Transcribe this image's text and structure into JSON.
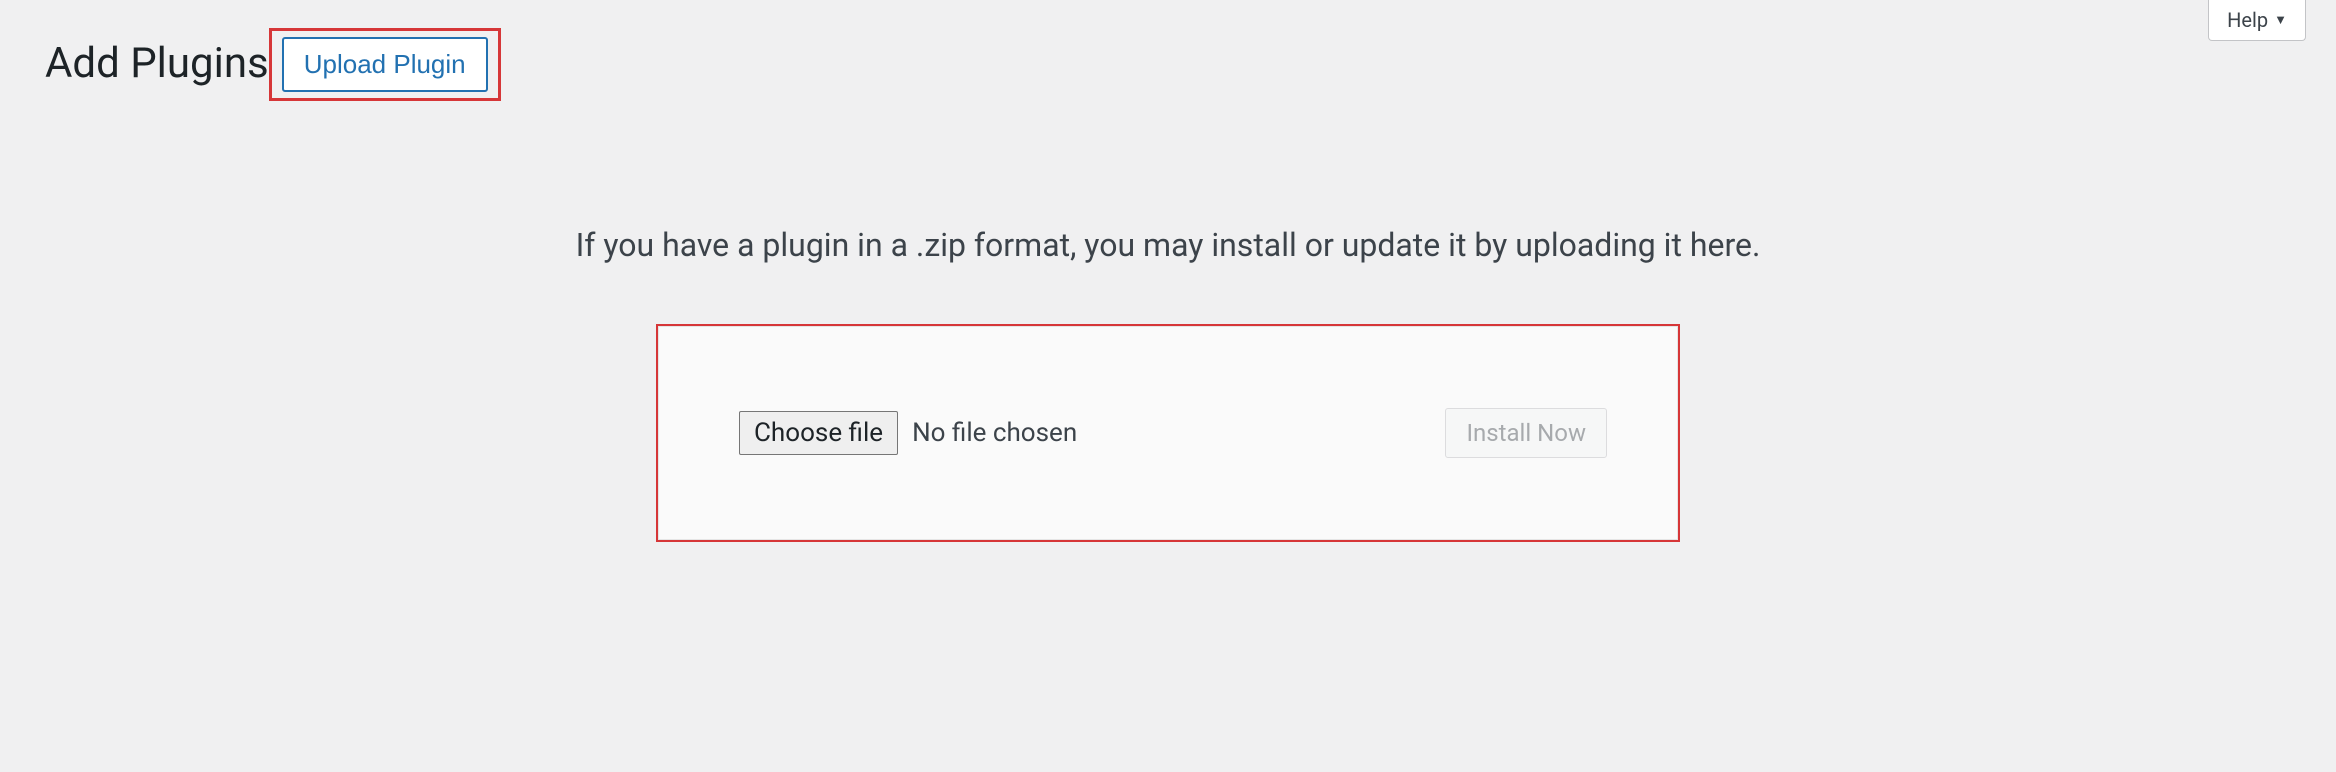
{
  "help": {
    "label": "Help"
  },
  "header": {
    "title": "Add Plugins",
    "upload_button": "Upload Plugin"
  },
  "upload": {
    "instruction": "If you have a plugin in a .zip format, you may install or update it by uploading it here.",
    "choose_file_label": "Choose file",
    "file_status": "No file chosen",
    "install_button": "Install Now"
  }
}
